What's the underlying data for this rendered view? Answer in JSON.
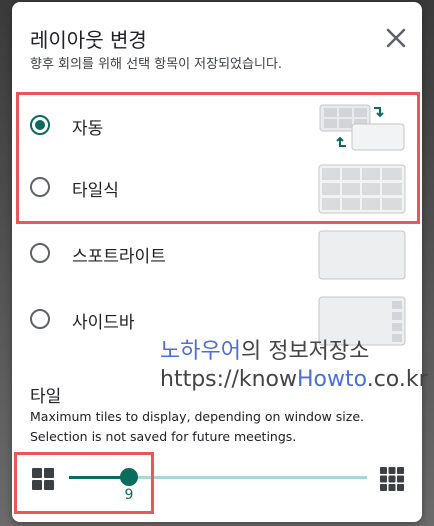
{
  "dialog": {
    "title": "레이아웃 변경",
    "subtitle": "향후 회의를 위해 선택 항목이 저장되었습니다.",
    "close_icon": "close-icon"
  },
  "layout_options": [
    {
      "label": "자동",
      "selected": true
    },
    {
      "label": "타일식",
      "selected": false
    },
    {
      "label": "스포트라이트",
      "selected": false
    },
    {
      "label": "사이드바",
      "selected": false
    }
  ],
  "watermark": {
    "line1_blue": "노하우어",
    "line1_rest": "의 정보저장소",
    "line2_pre": "https://know",
    "line2_blue": "Howto",
    "line2_post": ".co.kr"
  },
  "tiles": {
    "title": "타일",
    "description": "Maximum tiles to display, depending on window size. Selection is not saved for future meetings.",
    "slider_value": "9",
    "slider_fraction": 0.2,
    "min_icon": "grid-small-icon",
    "max_icon": "grid-large-icon"
  },
  "colors": {
    "accent": "#0b6b5c",
    "track_inactive": "#a8d8cf",
    "highlight": "#e8575a"
  }
}
